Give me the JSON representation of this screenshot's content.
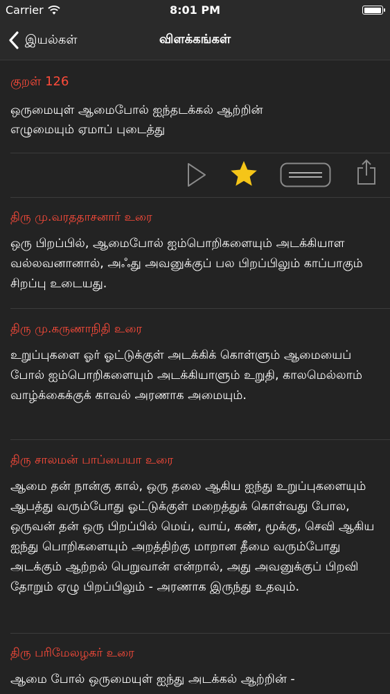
{
  "status": {
    "carrier": "Carrier",
    "time": "8:01 PM",
    "battery_level": 1.0
  },
  "nav": {
    "back_label": "இயல்கள்",
    "title": "விளக்கங்கள்"
  },
  "kural": {
    "number": "குறள் 126",
    "line1": "ஒருமையுள் ஆமைபோல் ஐந்தடக்கல் ஆற்றின்",
    "line2": "எழுமையும் ஏமாப் புடைத்து"
  },
  "toolbar": {
    "icons": [
      "play-icon",
      "star-icon",
      "text-size-icon",
      "share-icon"
    ],
    "accent_color": "#f5c518"
  },
  "commentaries": [
    {
      "author": "திரு மு.வரததாசனார் உரை",
      "text": "ஒரு பிறப்பில், ஆமைபோல் ஐம்பொறிகளையும் அடக்கியாள வல்லவனானால், அஃது அவனுக்குப் பல பிறப்பிலும் காப்பாகும் சிறப்பு உடையது."
    },
    {
      "author": "திரு மு.கருணாநிதி உரை",
      "text": "உறுப்புகளை ஓர் ஓட்டுக்குள் அடக்கிக் கொள்ளும் ஆமையைப் போல் ஐம்பொறிகளையும் அடக்கியாளும் உறுதி, காலமெல்லாம் வாழ்க்கைக்குக் காவல் அரணாக அமையும்."
    },
    {
      "author": "திரு சாலமன் பாப்பையா உரை",
      "text": "ஆமை தன் நான்கு கால், ஒரு தலை ஆகிய ஐந்து உறுப்புகளையும் ஆபத்து வரும்போது ஓட்டுக்குள் மறைத்துக் கொள்வது போல, ஒருவன் தன் ஒரு பிறப்பில் மெய், வாய், கண், மூக்கு, செவி ஆகிய ஐந்து பொறிகளையும் அறத்திற்கு மாறான தீமை வரும்போது அடக்கும் ஆற்றல் பெறுவான் என்றால், அது அவனுக்குப் பிறவி தோறும் ஏழு பிறப்பிலும் - அரணாக இருந்து உதவும்."
    },
    {
      "author": "திரு பரிமேலழகர் உரை",
      "text": "ஆமை போல் ஒருமையுள் ஐந்து அடக்கல் ஆற்றின் -"
    }
  ],
  "colors": {
    "accent_red": "#ff4b3a",
    "background": "#232323"
  }
}
